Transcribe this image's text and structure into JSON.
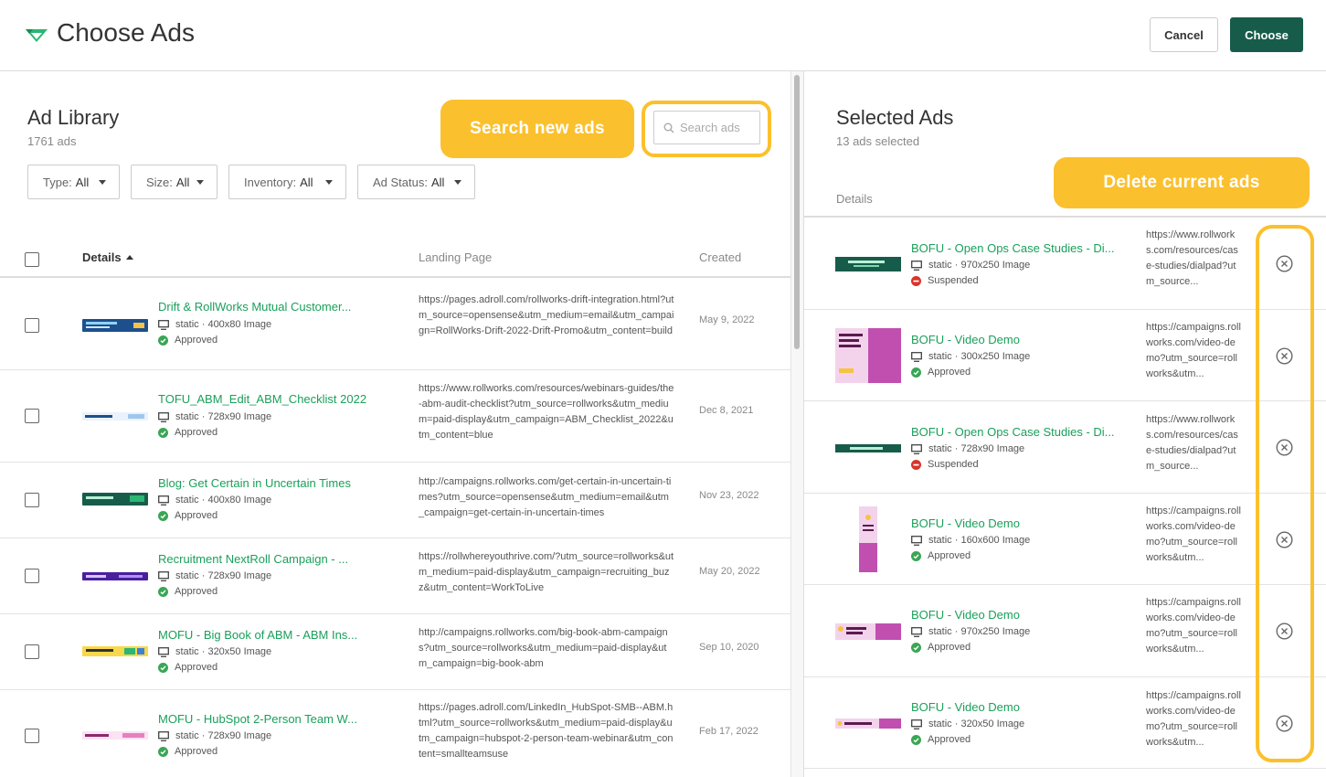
{
  "header": {
    "title": "Choose Ads",
    "cancel_label": "Cancel",
    "choose_label": "Choose",
    "brand_color": "#175c4a"
  },
  "library": {
    "title": "Ad Library",
    "count": "1761 ads",
    "search_placeholder": "Search ads",
    "callout_search": "Search new ads",
    "filters": [
      {
        "label": "Type:",
        "value": "All"
      },
      {
        "label": "Size:",
        "value": "All"
      },
      {
        "label": "Inventory:",
        "value": "All"
      },
      {
        "label": "Ad Status:",
        "value": "All"
      }
    ],
    "columns": {
      "details": "Details",
      "landing": "Landing Page",
      "created": "Created"
    },
    "rows": [
      {
        "name": "Drift & RollWorks Mutual Customer...",
        "meta": "static · 400x80 Image",
        "status": "Approved",
        "landing": "https://pages.adroll.com/rollworks-drift-integration.html?utm_source=opensense&utm_medium=email&utm_campaign=RollWorks-Drift-2022-Drift-Promo&utm_content=build",
        "created": "May 9, 2022"
      },
      {
        "name": "TOFU_ABM_Edit_ABM_Checklist 2022",
        "meta": "static · 728x90 Image",
        "status": "Approved",
        "landing": "https://www.rollworks.com/resources/webinars-guides/the-abm-audit-checklist?utm_source=rollworks&utm_medium=paid-display&utm_campaign=ABM_Checklist_2022&utm_content=blue",
        "created": "Dec 8, 2021"
      },
      {
        "name": "Blog: Get Certain in Uncertain Times",
        "meta": "static · 400x80 Image",
        "status": "Approved",
        "landing": "http://campaigns.rollworks.com/get-certain-in-uncertain-times?utm_source=opensense&utm_medium=email&utm_campaign=get-certain-in-uncertain-times",
        "created": "Nov 23, 2022"
      },
      {
        "name": "Recruitment NextRoll Campaign - ...",
        "meta": "static · 728x90 Image",
        "status": "Approved",
        "landing": "https://rollwhereyouthrive.com/?utm_source=rollworks&utm_medium=paid-display&utm_campaign=recruiting_buzz&utm_content=WorkToLive",
        "created": "May 20, 2022"
      },
      {
        "name": "MOFU - Big Book of ABM - ABM Ins...",
        "meta": "static · 320x50 Image",
        "status": "Approved",
        "landing": "http://campaigns.rollworks.com/big-book-abm-campaigns?utm_source=rollworks&utm_medium=paid-display&utm_campaign=big-book-abm",
        "created": "Sep 10, 2020"
      },
      {
        "name": "MOFU - HubSpot 2-Person Team W...",
        "meta": "static · 728x90 Image",
        "status": "Approved",
        "landing": "https://pages.adroll.com/LinkedIn_HubSpot-SMB--ABM.html?utm_source=rollworks&utm_medium=paid-display&utm_campaign=hubspot-2-person-team-webinar&utm_content=smallteamsuse",
        "created": "Feb 17, 2022"
      }
    ]
  },
  "selected": {
    "title": "Selected Ads",
    "count": "13 ads selected",
    "details_header": "Details",
    "callout_delete": "Delete current ads",
    "rows": [
      {
        "name": "BOFU - Open Ops Case Studies - Di...",
        "meta": "static · 970x250 Image",
        "status": "Suspended",
        "landing": "https://www.rollworks.com/resources/case-studies/dialpad?utm_source..."
      },
      {
        "name": "BOFU - Video Demo",
        "meta": "static · 300x250 Image",
        "status": "Approved",
        "landing": "https://campaigns.rollworks.com/video-demo?utm_source=rollworks&utm..."
      },
      {
        "name": "BOFU - Open Ops Case Studies - Di...",
        "meta": "static · 728x90 Image",
        "status": "Suspended",
        "landing": "https://www.rollworks.com/resources/case-studies/dialpad?utm_source..."
      },
      {
        "name": "BOFU - Video Demo",
        "meta": "static · 160x600 Image",
        "status": "Approved",
        "landing": "https://campaigns.rollworks.com/video-demo?utm_source=rollworks&utm..."
      },
      {
        "name": "BOFU - Video Demo",
        "meta": "static · 970x250 Image",
        "status": "Approved",
        "landing": "https://campaigns.rollworks.com/video-demo?utm_source=rollworks&utm..."
      },
      {
        "name": "BOFU - Video Demo",
        "meta": "static · 320x50 Image",
        "status": "Approved",
        "landing": "https://campaigns.rollworks.com/video-demo?utm_source=rollworks&utm..."
      }
    ]
  },
  "colors": {
    "link_green": "#1aa05a",
    "approved": "#3aa655",
    "suspended": "#d9342b",
    "callout": "#fbc02d"
  }
}
